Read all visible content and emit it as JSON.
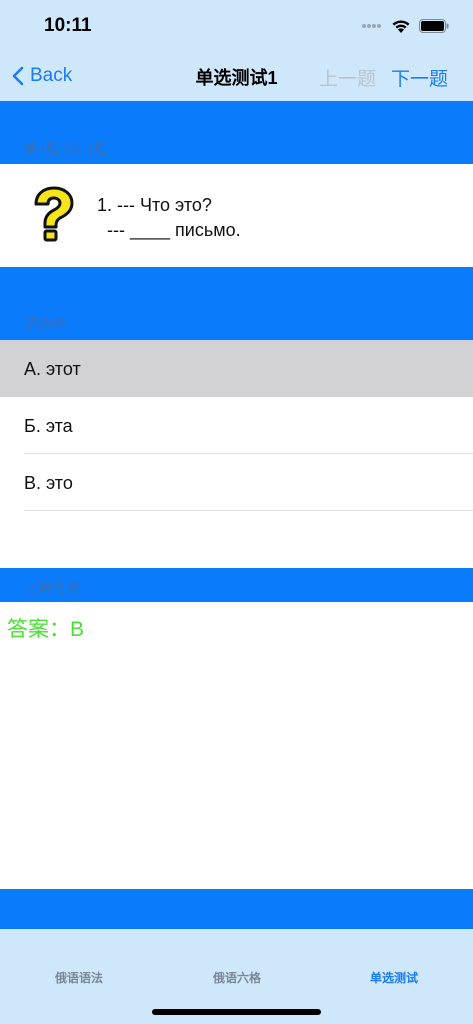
{
  "status": {
    "time": "10:11"
  },
  "nav": {
    "back_label": "Back",
    "title": "单选测试1",
    "prev_label": "上一题",
    "next_label": "下一题"
  },
  "question": {
    "counter": "第1题 /共 4题",
    "text": "1. --- Что это?\n  --- ____ письмо."
  },
  "options": {
    "header": "请选择",
    "items": [
      {
        "label": "А. этот",
        "selected": true
      },
      {
        "label": "Б. эта",
        "selected": false
      },
      {
        "label": "В. это",
        "selected": false
      }
    ]
  },
  "answer": {
    "header": "正确答案",
    "text": "答案：В"
  },
  "tabs": [
    {
      "label": "俄语语法",
      "active": false
    },
    {
      "label": "俄语六格",
      "active": false
    },
    {
      "label": "单选测试",
      "active": true
    }
  ],
  "colors": {
    "band": "#0a7cfb",
    "bars": "#cfe7fb",
    "accent": "#1a7cf5",
    "answer": "#48e033"
  }
}
